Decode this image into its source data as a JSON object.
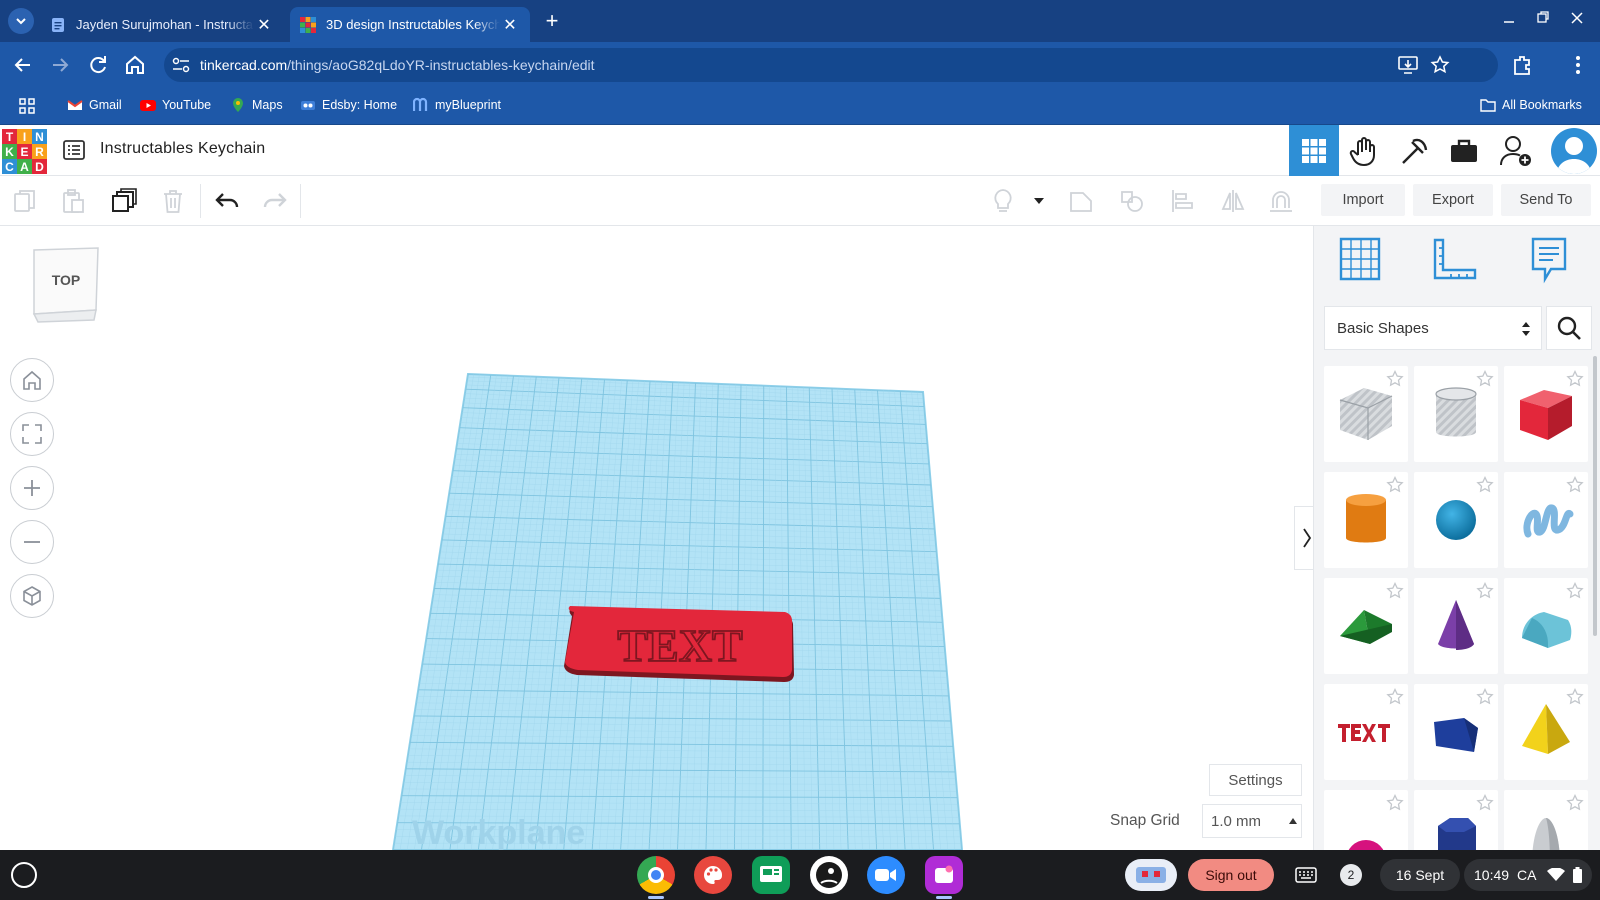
{
  "browser": {
    "tabs": [
      {
        "title": "Jayden Surujmohan - Instructables",
        "active": false
      },
      {
        "title": "3D design Instructables Keychain",
        "active": true
      }
    ],
    "url_host": "tinkercad.com",
    "url_path": "/things/aoG82qLdoYR-instructables-keychain/edit",
    "bookmarks": [
      "Gmail",
      "YouTube",
      "Maps",
      "Edsby: Home",
      "myBlueprint"
    ],
    "all_bookmarks": "All Bookmarks"
  },
  "app": {
    "logo_letters": [
      "T",
      "I",
      "N",
      "K",
      "E",
      "R",
      "C",
      "A",
      "D"
    ],
    "design_title": "Instructables Keychain",
    "toolbar": {
      "import": "Import",
      "export": "Export",
      "send_to": "Send To"
    }
  },
  "canvas": {
    "view_cube_label": "TOP",
    "workplane_label": "Workplane",
    "object_text": "TEXT",
    "settings": "Settings",
    "snap_grid_label": "Snap Grid",
    "snap_grid_value": "1.0 mm"
  },
  "panel": {
    "category": "Basic Shapes",
    "shapes": [
      "Box (hole)",
      "Cylinder (hole)",
      "Box",
      "Cylinder",
      "Sphere",
      "Scribble",
      "Roof",
      "Cone",
      "Round Roof",
      "Text",
      "Polygon",
      "Pyramid",
      "Half Sphere",
      "Hexagonal Prism",
      "Paraboloid"
    ]
  },
  "taskbar": {
    "notifications": "2",
    "sign_out": "Sign out",
    "date": "16 Sept",
    "time": "10:49",
    "region": "CA"
  },
  "colors": {
    "chrome_dark": "#174182",
    "chrome": "#1e58a8",
    "workplane": "#aee3f5",
    "accent": "#2e8fd6",
    "red": "#e3273b"
  }
}
